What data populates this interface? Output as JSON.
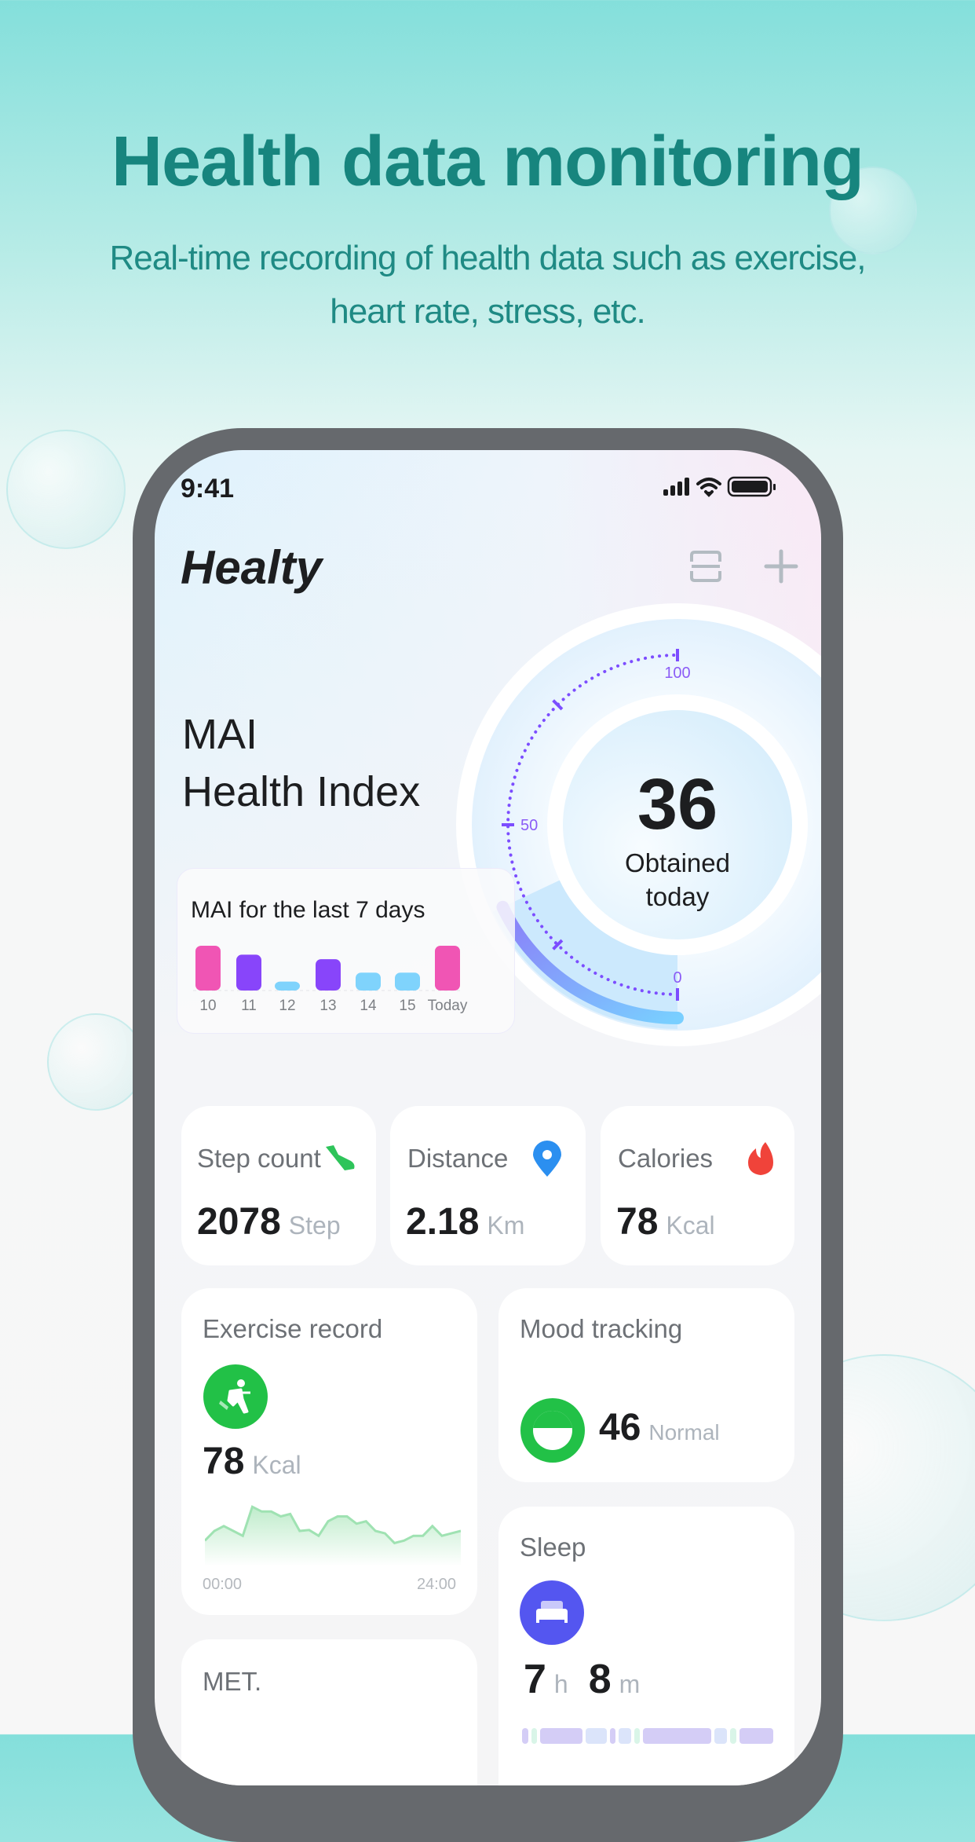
{
  "hero": {
    "title": "Health data monitoring",
    "subtitle": "Real-time recording of health data such as exercise, heart rate, stress, etc."
  },
  "status_bar": {
    "time": "9:41",
    "icons": [
      "signal-icon",
      "wifi-icon",
      "battery-icon"
    ]
  },
  "header": {
    "app_name": "Healty",
    "icons": [
      "scan-icon",
      "plus-icon"
    ]
  },
  "health_index": {
    "line1": "MAI",
    "line2": "Health Index",
    "value": "36",
    "value_numeric": 36,
    "max": 100,
    "caption_line1": "Obtained",
    "caption_line2": "today",
    "scale_labels": [
      "100",
      "50",
      "0"
    ],
    "colors": {
      "arc_start": "#8b7cf8",
      "arc_end": "#79cfff",
      "ticks": "#7c4dff"
    }
  },
  "mai_7days": {
    "title": "MAI for the last 7 days"
  },
  "chart_data": {
    "type": "bar",
    "title": "MAI for the last 7 days",
    "categories": [
      "10",
      "11",
      "12",
      "13",
      "14",
      "15",
      "Today"
    ],
    "values": [
      50,
      40,
      10,
      35,
      20,
      20,
      50
    ],
    "colors": [
      "#f055b4",
      "#8845fa",
      "#7fd3fc",
      "#8845fa",
      "#7fd3fc",
      "#7fd3fc",
      "#f055b4"
    ],
    "grid": false
  },
  "stats": [
    {
      "label": "Step count",
      "value": "2078",
      "unit": "Step",
      "icon": "shoe-icon",
      "color": "#2ec45a"
    },
    {
      "label": "Distance",
      "value": "2.18",
      "unit": "Km",
      "icon": "location-pin-icon",
      "color": "#2b8ff0"
    },
    {
      "label": "Calories",
      "value": "78",
      "unit": "Kcal",
      "icon": "flame-icon",
      "color": "#f0433a"
    }
  ],
  "exercise": {
    "title": "Exercise record",
    "value": "78",
    "unit": "Kcal",
    "icon": "running-icon",
    "color": "#22c147",
    "x_start": "00:00",
    "x_end": "24:00",
    "series": [
      4,
      6,
      7,
      6,
      5,
      11,
      10,
      10,
      9,
      9.5,
      6,
      6.2,
      5,
      8,
      9,
      9,
      7.5,
      8,
      6,
      5.5,
      3.5,
      4,
      5,
      5,
      7,
      5,
      5.5,
      6
    ]
  },
  "mood": {
    "title": "Mood tracking",
    "value": "46",
    "status": "Normal",
    "icon": "smile-icon",
    "color": "#22c147"
  },
  "sleep": {
    "title": "Sleep",
    "hours": "7",
    "hours_unit": "h",
    "minutes": "8",
    "minutes_unit": "m",
    "icon": "bed-icon",
    "color": "#5456f0"
  },
  "met": {
    "title": "MET."
  }
}
